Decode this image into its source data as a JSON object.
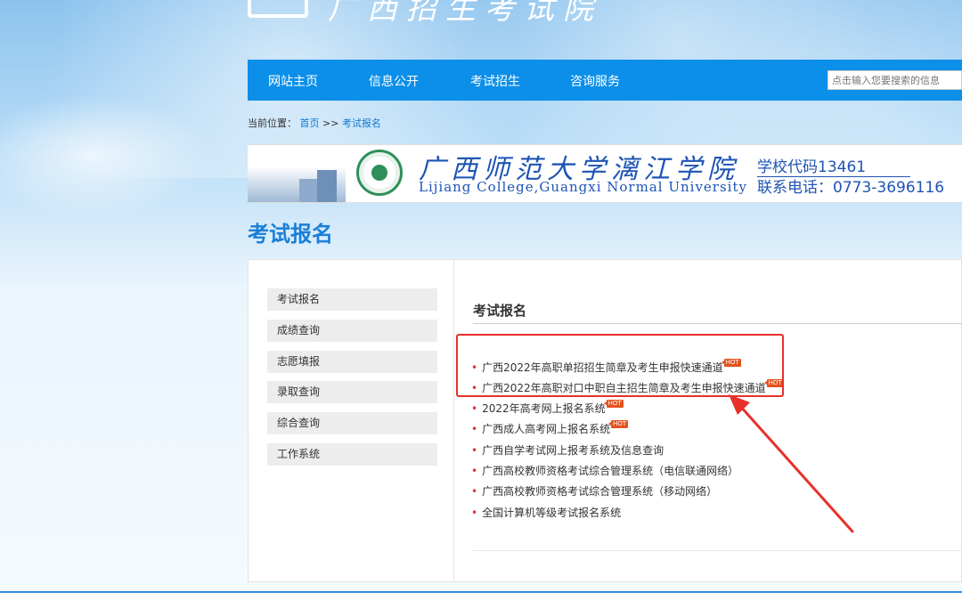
{
  "header": {
    "site_title": "广西招生考试院"
  },
  "nav": {
    "items": [
      "网站主页",
      "信息公开",
      "考试招生",
      "咨询服务"
    ],
    "search_placeholder": "点击输入您要搜索的信息"
  },
  "breadcrumb": {
    "prefix": "当前位置：",
    "home": "首页",
    "sep": " >> ",
    "current": "考试报名"
  },
  "banner": {
    "college_cn": "广西师范大学漓江学院",
    "college_en": "Lijiang College,Guangxi Normal University",
    "school_code": "学校代码13461",
    "phone": "联系电话：0773-3696116"
  },
  "page": {
    "heading": "考试报名"
  },
  "sidebar": {
    "items": [
      "考试报名",
      "成绩查询",
      "志愿填报",
      "录取查询",
      "综合查询",
      "工作系统"
    ]
  },
  "content": {
    "title": "考试报名",
    "hot_label": "HOT",
    "links": [
      "广西2022年高职单招招生简章及考生申报快速通道",
      "广西2022年高职对口中职自主招生简章及考生申报快速通道",
      "2022年高考网上报名系统",
      "广西成人高考网上报名系统",
      "广西自学考试网上报考系统及信息查询",
      "广西高校教师资格考试综合管理系统（电信联通网络）",
      "广西高校教师资格考试综合管理系统（移动网络）",
      "全国计算机等级考试报名系统"
    ]
  },
  "colors": {
    "nav_bg": "#0c8fe8",
    "heading": "#1a7fd6",
    "highlight": "#e8302a",
    "hot_badge": "#e4521f",
    "college_text": "#1e54b4"
  }
}
